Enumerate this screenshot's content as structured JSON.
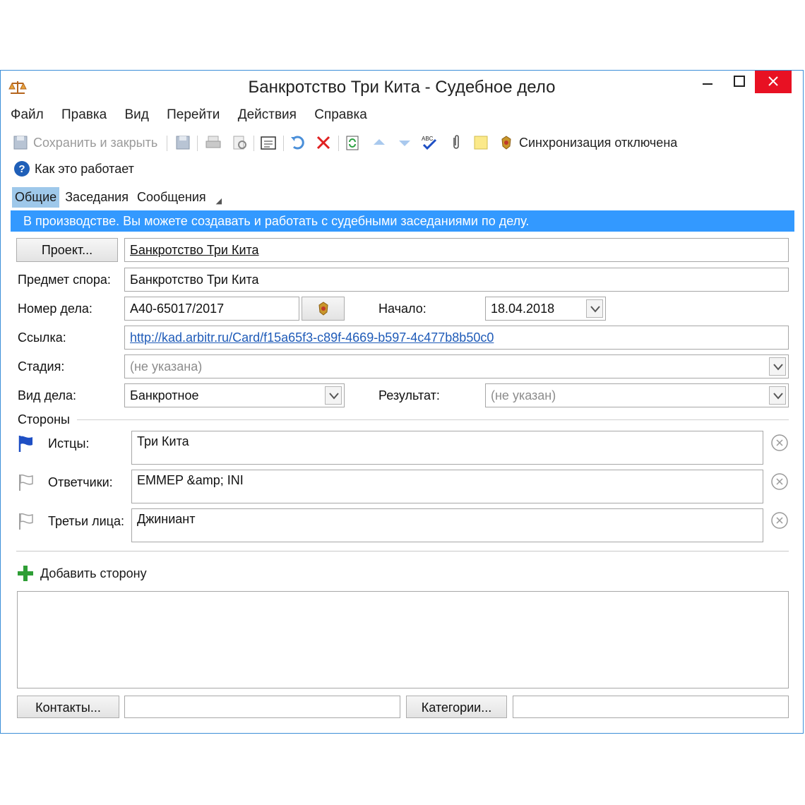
{
  "window": {
    "title": "Банкротство Три Кита - Судебное дело",
    "app_icon": "scales-icon",
    "controls": {
      "minimize": "—",
      "maximize": "☐",
      "close": "✕"
    },
    "close_color": "#e81123",
    "border_color": "#3c8fd8"
  },
  "menu": [
    "Файл",
    "Правка",
    "Вид",
    "Перейти",
    "Действия",
    "Справка"
  ],
  "toolbar": {
    "save_close": "Сохранить и закрыть",
    "sync_status": "Синхронизация отключена",
    "icons": [
      "save-close-icon",
      "save-icon",
      "print-icon",
      "print-preview-icon",
      "properties-icon",
      "undo-icon",
      "delete-icon",
      "refresh-icon",
      "up-icon",
      "down-icon",
      "spellcheck-icon",
      "attach-icon",
      "note-icon",
      "emblem-icon"
    ]
  },
  "help": {
    "label": "Как это работает"
  },
  "tabs": [
    "Общие",
    "Заседания",
    "Сообщения"
  ],
  "active_tab": "Общие",
  "banner": {
    "text": "В производстве. Вы можете создавать и работать с судебными заседаниями по делу.",
    "color": "#3399ff"
  },
  "form": {
    "project_button": "Проект...",
    "project_value": "Банкротство Три Кита",
    "subject_label": "Предмет спора:",
    "subject_value": "Банкротство Три Кита",
    "case_number_label": "Номер дела:",
    "case_number_value": "А40-65017/2017",
    "start_label": "Начало:",
    "start_value": "18.04.2018",
    "link_label": "Ссылка:",
    "link_value": "http://kad.arbitr.ru/Card/f15a65f3-c89f-4669-b597-4c477b8b50c0",
    "stage_label": "Стадия:",
    "stage_value": "(не указана)",
    "case_type_label": "Вид дела:",
    "case_type_value": "Банкротное",
    "result_label": "Результат:",
    "result_value": "(не указан)"
  },
  "parties": {
    "title": "Стороны",
    "items": [
      {
        "label": "Истцы:",
        "value": "Три Кита",
        "flag_color": "#1e4fc4"
      },
      {
        "label": "Ответчики:",
        "value": "EMMEP &amp; INI",
        "flag_color": "#a0a0a0"
      },
      {
        "label": "Третьи лица:",
        "value": "Джиниант",
        "flag_color": "#a0a0a0"
      }
    ],
    "add_label": "Добавить сторону"
  },
  "footer": {
    "contacts_button": "Контакты...",
    "categories_button": "Категории..."
  }
}
